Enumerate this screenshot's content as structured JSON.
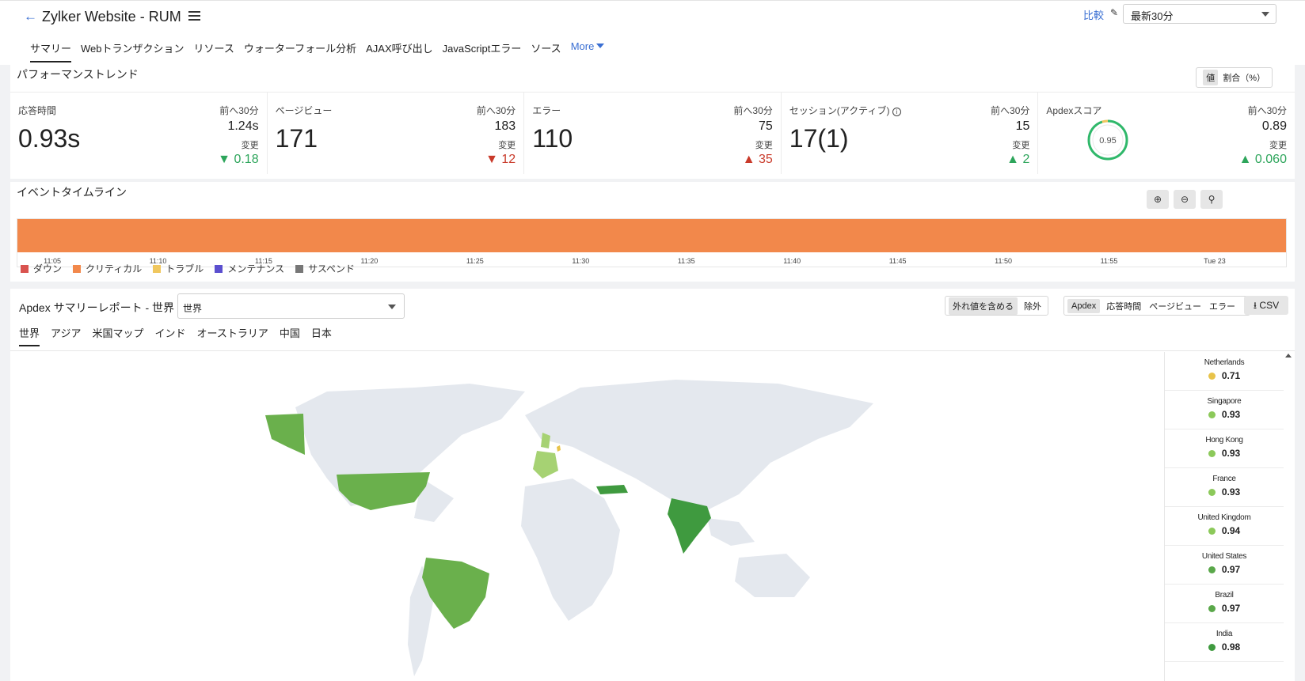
{
  "header": {
    "back_icon": "arrow-left-icon",
    "title": "Zylker Website - RUM",
    "compare_label": "比較",
    "time_range": "最新30分"
  },
  "tabs": [
    "サマリー",
    "Webトランザクション",
    "リソース",
    "ウォーターフォール分析",
    "AJAX呼び出し",
    "JavaScriptエラー",
    "ソース"
  ],
  "tabs_more": "More",
  "performance": {
    "title": "パフォーマンストレンド",
    "toggle": {
      "value": "値",
      "percent": "割合（%）"
    },
    "metrics": [
      {
        "label": "応答時間",
        "value": "0.93s",
        "prev_label": "前へ30分",
        "prev": "1.24s",
        "change_label": "変更",
        "change": "0.18",
        "arrow": "▼",
        "status": "good"
      },
      {
        "label": "ページビュー",
        "value": "171",
        "prev_label": "前へ30分",
        "prev": "183",
        "change_label": "変更",
        "change": "12",
        "arrow": "▼",
        "status": "bad"
      },
      {
        "label": "エラー",
        "value": "110",
        "prev_label": "前へ30分",
        "prev": "75",
        "change_label": "変更",
        "change": "35",
        "arrow": "▲",
        "status": "bad"
      },
      {
        "label": "セッション(アクティブ)",
        "value": "17(1)",
        "prev_label": "前へ30分",
        "prev": "15",
        "change_label": "変更",
        "change": "2",
        "arrow": "▲",
        "status": "good"
      },
      {
        "label": "Apdexスコア",
        "gauge": "0.95",
        "gauge_fraction": 0.95,
        "prev_label": "前へ30分",
        "prev": "0.89",
        "change_label": "変更",
        "change": "0.060",
        "arrow": "▲",
        "status": "good"
      }
    ]
  },
  "events": {
    "title": "イベントタイムライン",
    "ticks": [
      "11:05",
      "11:10",
      "11:15",
      "11:20",
      "11:25",
      "11:30",
      "11:35",
      "11:40",
      "11:45",
      "11:50",
      "11:55",
      "Tue 23"
    ],
    "bar_status": "クリティカル",
    "legend": [
      {
        "label": "ダウン",
        "color": "#d9534f"
      },
      {
        "label": "クリティカル",
        "color": "#f2884b"
      },
      {
        "label": "トラブル",
        "color": "#f0c75e"
      },
      {
        "label": "メンテナンス",
        "color": "#5b4fcf"
      },
      {
        "label": "サスペンド",
        "color": "#777777"
      }
    ]
  },
  "apdex": {
    "title": "Apdex サマリーレポート - 世界",
    "region_value": "世界",
    "outlier": {
      "include": "外れ値を含める",
      "exclude": "除外"
    },
    "metrics": [
      "Apdex",
      "応答時間",
      "ページビュー",
      "エラー"
    ],
    "csv_label": "CSV",
    "region_tabs": [
      "世界",
      "アジア",
      "米国マップ",
      "インド",
      "オーストラリア",
      "中国",
      "日本"
    ],
    "countries": [
      {
        "name": "Netherlands",
        "value": "0.71",
        "color": "#e8c34a"
      },
      {
        "name": "Singapore",
        "value": "0.93",
        "color": "#8cc95a"
      },
      {
        "name": "Hong Kong",
        "value": "0.93",
        "color": "#8cc95a"
      },
      {
        "name": "France",
        "value": "0.93",
        "color": "#8cc95a"
      },
      {
        "name": "United Kingdom",
        "value": "0.94",
        "color": "#8cc95a"
      },
      {
        "name": "United States",
        "value": "0.97",
        "color": "#5aa84a"
      },
      {
        "name": "Brazil",
        "value": "0.97",
        "color": "#5aa84a"
      },
      {
        "name": "India",
        "value": "0.98",
        "color": "#3f9a3f"
      }
    ]
  }
}
